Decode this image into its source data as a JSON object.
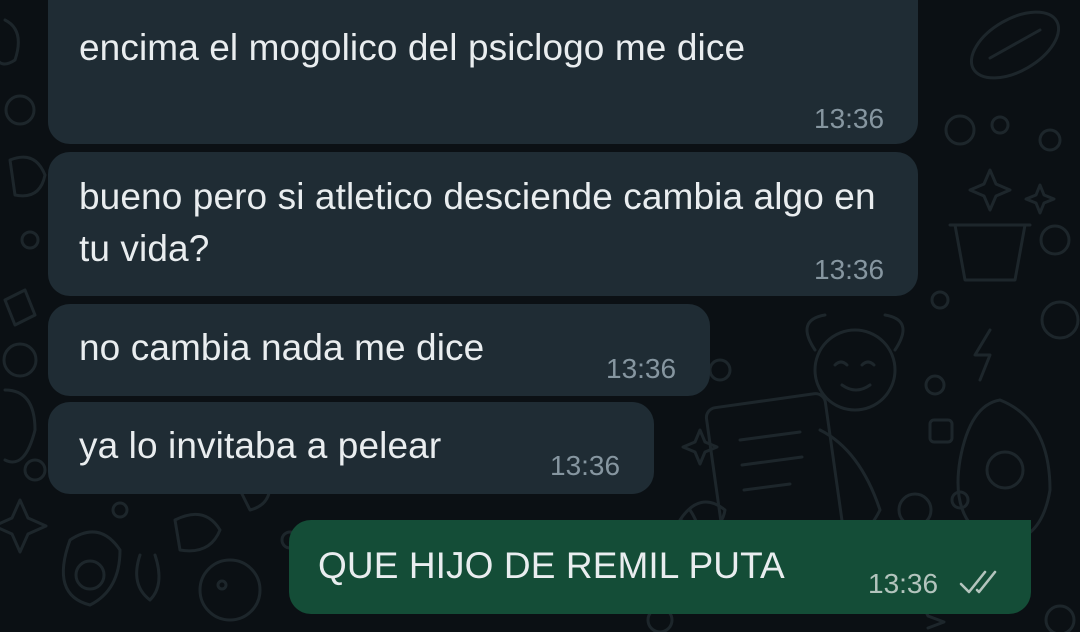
{
  "messages": [
    {
      "direction": "incoming",
      "text": "encima el mogolico del psiclogo me dice",
      "time": "13:36"
    },
    {
      "direction": "incoming",
      "text": "bueno pero si atletico desciende cambia algo en tu vida?",
      "time": "13:36"
    },
    {
      "direction": "incoming",
      "text": "no cambia nada me dice",
      "time": "13:36"
    },
    {
      "direction": "incoming",
      "text": "ya lo invitaba a pelear",
      "time": "13:36"
    },
    {
      "direction": "outgoing",
      "text": "QUE HIJO DE REMIL PUTA",
      "time": "13:36",
      "status": "read-double-check-icon"
    }
  ],
  "colors": {
    "background": "#0b1014",
    "incoming_bubble": "#1f2c34",
    "outgoing_bubble": "#144d37",
    "message_text": "#e9edef",
    "timestamp": "#8696a0"
  }
}
